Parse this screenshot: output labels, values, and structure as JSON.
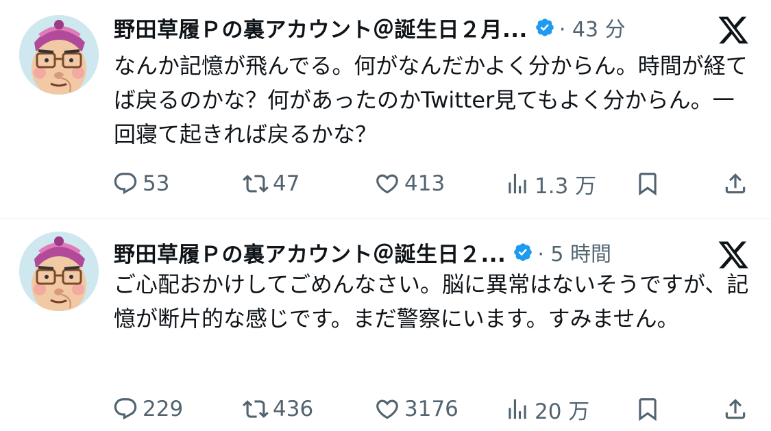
{
  "tweets": [
    {
      "author_name": "野田草履Ｐの裏アカウント＠誕生日２月...",
      "time_meta": "· 43 分",
      "text": "なんか記憶が飛んでる。何がなんだかよく分からん。時間が経てば戻るのかな？何があったのかTwitter見てもよく分からん。一回寝て起きれば戻るかな？",
      "replies": "53",
      "retweets": "47",
      "likes": "413",
      "views": "1.3 万"
    },
    {
      "author_name": "野田草履Ｐの裏アカウント＠誕生日２...",
      "time_meta": "· 5 時間",
      "text": "ご心配おかけしてごめんなさい。脳に異常はないそうですが、記憶が断片的な感じです。まだ警察にいます。すみません。",
      "replies": "229",
      "retweets": "436",
      "likes": "3176",
      "views": "20 万"
    }
  ],
  "icons": {
    "verified": "verified-badge-icon",
    "platform": "x-logo-icon",
    "reply": "reply-icon",
    "retweet": "retweet-icon",
    "like": "heart-icon",
    "views": "views-icon",
    "bookmark": "bookmark-icon",
    "share": "share-icon"
  },
  "colors": {
    "text": "#0f1419",
    "secondary": "#536471",
    "verified": "#1d9bf0",
    "divider": "#eff3f4"
  }
}
